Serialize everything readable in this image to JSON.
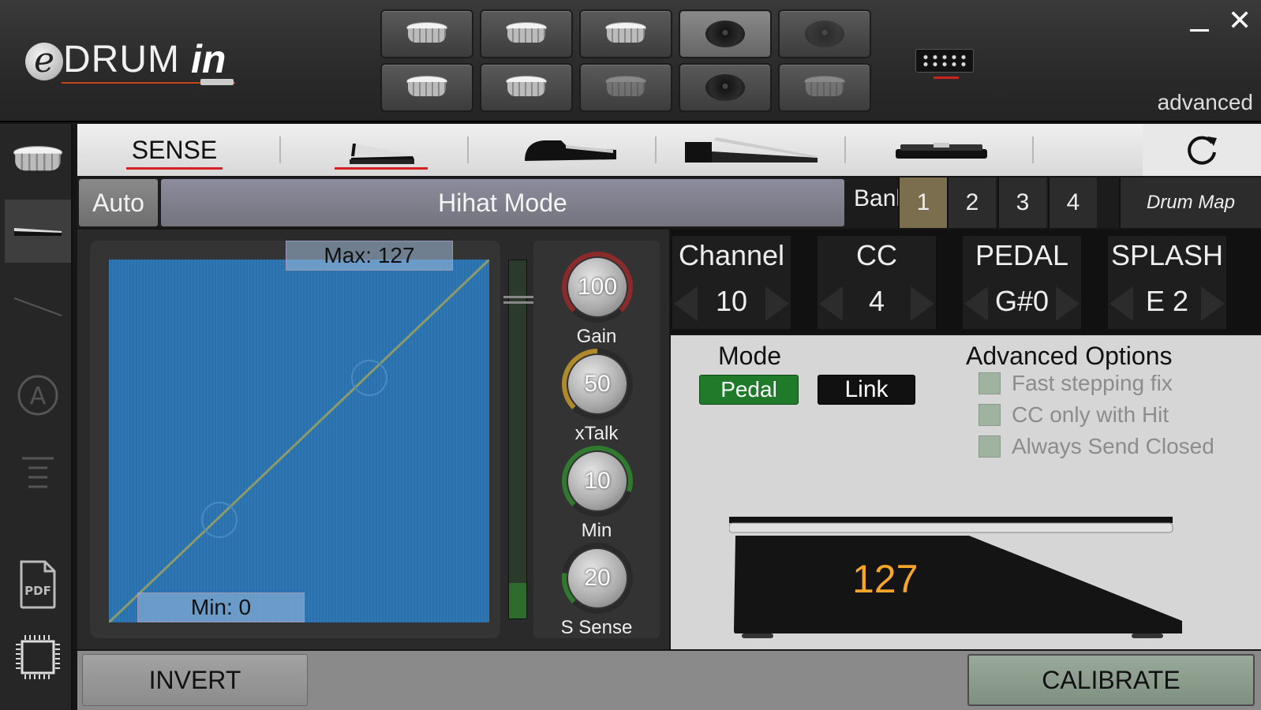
{
  "header": {
    "logo": {
      "e": "e",
      "drum": "DRUM",
      "in": "in"
    },
    "mode_label": "advanced",
    "window": {
      "minimize_icon": "minimize-icon",
      "close_icon": "close-icon",
      "close_glyph": "✕"
    }
  },
  "pads": [
    {
      "type": "drum",
      "active": false,
      "dim": false
    },
    {
      "type": "drum",
      "active": false,
      "dim": false
    },
    {
      "type": "drum",
      "active": false,
      "dim": false
    },
    {
      "type": "cymbal",
      "active": true,
      "dim": false
    },
    {
      "type": "cymbal",
      "active": false,
      "dim": true
    },
    {
      "type": "drum",
      "active": false,
      "dim": false
    },
    {
      "type": "drum",
      "active": false,
      "dim": false
    },
    {
      "type": "drum",
      "active": false,
      "dim": true
    },
    {
      "type": "cymbal",
      "active": false,
      "dim": false
    },
    {
      "type": "drum",
      "active": false,
      "dim": true
    }
  ],
  "sidebar": {
    "items": [
      {
        "icon": "drum-icon"
      },
      {
        "icon": "pedal-icon",
        "selected": true
      },
      {
        "icon": "line-icon"
      },
      {
        "icon": "auto-a-icon"
      },
      {
        "icon": "menu-lines-icon"
      },
      {
        "icon": "pdf-icon",
        "text": "PDF"
      },
      {
        "icon": "chip-icon"
      }
    ]
  },
  "tabs": {
    "sense_label": "SENSE",
    "items": [
      "hihat-pedal-icon",
      "sustain-pedal-icon",
      "long-pedal-icon",
      "flat-pedal-icon"
    ],
    "refresh_icon": "refresh-icon"
  },
  "modebar": {
    "auto_label": "Auto",
    "hihat_mode_label": "Hihat Mode",
    "bank_label": "Bank",
    "banks": [
      "1",
      "2",
      "3",
      "4"
    ],
    "selected_bank": "1",
    "drum_map_label": "Drum Map"
  },
  "curve": {
    "max_label": "Max: 127",
    "min_label": "Min: 0",
    "level_fraction": 0.1,
    "colors": {
      "area": "#2e77b4",
      "line": "#8c9a6c"
    }
  },
  "knobs": [
    {
      "value": "100",
      "label": "Gain",
      "fraction": 1.0,
      "color": "#8a2a2a"
    },
    {
      "value": "50",
      "label": "xTalk",
      "fraction": 0.5,
      "color": "#b08a2a"
    },
    {
      "value": "10",
      "label": "Min",
      "fraction": 0.9,
      "color": "#2f7a2f"
    },
    {
      "value": "20",
      "label": "S Sense",
      "fraction": 0.2,
      "color": "#2f7a2f"
    }
  ],
  "params": [
    {
      "title": "Channel",
      "value": "10"
    },
    {
      "title": "CC",
      "value": "4"
    },
    {
      "title": "PEDAL",
      "value": "G#0"
    },
    {
      "title": "SPLASH",
      "value": "E 2"
    }
  ],
  "options": {
    "mode_title": "Mode",
    "pedal_label": "Pedal",
    "link_label": "Link",
    "advanced_title": "Advanced Options",
    "checkboxes": [
      {
        "label": "Fast stepping fix",
        "checked": false
      },
      {
        "label": "CC only with Hit",
        "checked": false
      },
      {
        "label": "Always Send Closed",
        "checked": false
      }
    ],
    "pedal_value": "127",
    "pedal_value_color": "#f5a52a"
  },
  "bottom": {
    "invert_label": "INVERT",
    "calibrate_label": "CALIBRATE"
  }
}
